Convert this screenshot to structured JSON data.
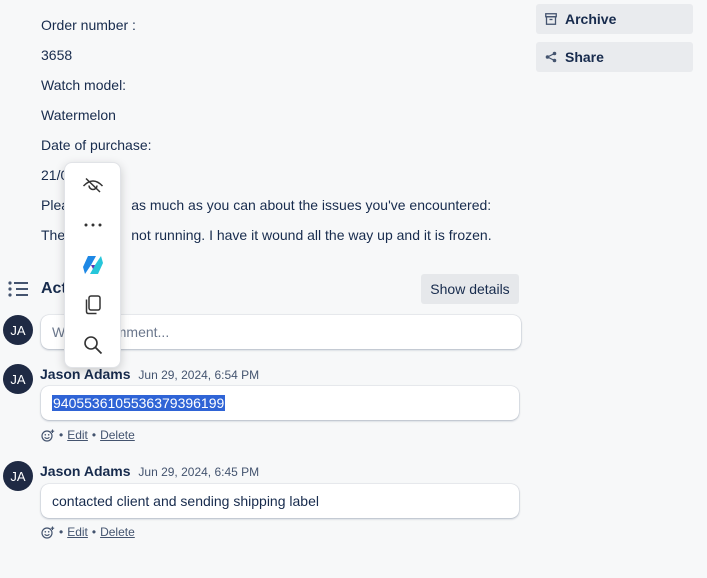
{
  "description": {
    "lines": [
      "Order number :",
      "3658",
      "Watch model:",
      "Watermelon",
      "Date of purchase:",
      "21/0",
      "Plea                as much as you can about the issues you've encountered:",
      "The                 not running. I have it wound all the way up and it is frozen."
    ]
  },
  "sidebar": {
    "archive_label": "Archive",
    "share_label": "Share"
  },
  "activity": {
    "title": "Act",
    "show_details_label": "Show details",
    "comment_placeholder": "Write a comment...",
    "user_initials": "JA"
  },
  "comments": [
    {
      "initials": "JA",
      "author": "Jason Adams",
      "timestamp": "Jun 29, 2024, 6:54 PM",
      "text": "9405536105536379396199",
      "edit_label": "Edit",
      "delete_label": "Delete"
    },
    {
      "initials": "JA",
      "author": "Jason Adams",
      "timestamp": "Jun 29, 2024, 6:45 PM",
      "text": "contacted client and sending shipping label",
      "edit_label": "Edit",
      "delete_label": "Delete"
    }
  ],
  "toolbar": {
    "icons": [
      "eye-off-icon",
      "more-icon",
      "copilot-icon",
      "copy-icon",
      "search-icon"
    ]
  },
  "colors": {
    "accent": "#2f64d6",
    "avatar": "#1f2a44",
    "background": "#f7f8f9"
  }
}
